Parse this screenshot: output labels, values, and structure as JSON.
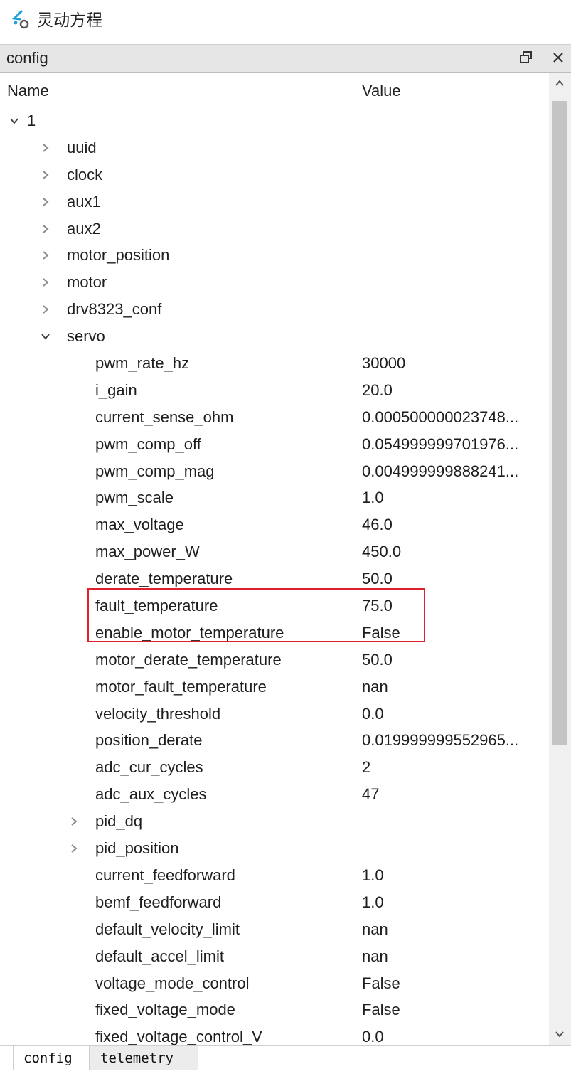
{
  "app": {
    "title": "灵动方程"
  },
  "panel": {
    "title": "config"
  },
  "columns": {
    "name": "Name",
    "value": "Value"
  },
  "rows": [
    {
      "label": "1",
      "value": "",
      "level": 0,
      "expander": "expanded"
    },
    {
      "label": "uuid",
      "value": "",
      "level": 1,
      "expander": "collapsed"
    },
    {
      "label": "clock",
      "value": "",
      "level": 1,
      "expander": "collapsed"
    },
    {
      "label": "aux1",
      "value": "",
      "level": 1,
      "expander": "collapsed"
    },
    {
      "label": "aux2",
      "value": "",
      "level": 1,
      "expander": "collapsed"
    },
    {
      "label": "motor_position",
      "value": "",
      "level": 1,
      "expander": "collapsed"
    },
    {
      "label": "motor",
      "value": "",
      "level": 1,
      "expander": "collapsed"
    },
    {
      "label": "drv8323_conf",
      "value": "",
      "level": 1,
      "expander": "collapsed"
    },
    {
      "label": "servo",
      "value": "",
      "level": 1,
      "expander": "expanded"
    },
    {
      "label": "pwm_rate_hz",
      "value": "30000",
      "level": 2,
      "expander": "none"
    },
    {
      "label": "i_gain",
      "value": "20.0",
      "level": 2,
      "expander": "none"
    },
    {
      "label": "current_sense_ohm",
      "value": "0.000500000023748...",
      "level": 2,
      "expander": "none"
    },
    {
      "label": "pwm_comp_off",
      "value": "0.054999999701976...",
      "level": 2,
      "expander": "none"
    },
    {
      "label": "pwm_comp_mag",
      "value": "0.004999999888241...",
      "level": 2,
      "expander": "none"
    },
    {
      "label": "pwm_scale",
      "value": "1.0",
      "level": 2,
      "expander": "none"
    },
    {
      "label": "max_voltage",
      "value": "46.0",
      "level": 2,
      "expander": "none"
    },
    {
      "label": "max_power_W",
      "value": "450.0",
      "level": 2,
      "expander": "none"
    },
    {
      "label": "derate_temperature",
      "value": "50.0",
      "level": 2,
      "expander": "none"
    },
    {
      "label": "fault_temperature",
      "value": "75.0",
      "level": 2,
      "expander": "none"
    },
    {
      "label": "enable_motor_temperature",
      "value": "False",
      "level": 2,
      "expander": "none"
    },
    {
      "label": "motor_derate_temperature",
      "value": "50.0",
      "level": 2,
      "expander": "none"
    },
    {
      "label": "motor_fault_temperature",
      "value": "nan",
      "level": 2,
      "expander": "none"
    },
    {
      "label": "velocity_threshold",
      "value": "0.0",
      "level": 2,
      "expander": "none"
    },
    {
      "label": "position_derate",
      "value": "0.019999999552965...",
      "level": 2,
      "expander": "none"
    },
    {
      "label": "adc_cur_cycles",
      "value": "2",
      "level": 2,
      "expander": "none"
    },
    {
      "label": "adc_aux_cycles",
      "value": "47",
      "level": 2,
      "expander": "none"
    },
    {
      "label": "pid_dq",
      "value": "",
      "level": 2,
      "expander": "collapsed"
    },
    {
      "label": "pid_position",
      "value": "",
      "level": 2,
      "expander": "collapsed"
    },
    {
      "label": "current_feedforward",
      "value": "1.0",
      "level": 2,
      "expander": "none"
    },
    {
      "label": "bemf_feedforward",
      "value": "1.0",
      "level": 2,
      "expander": "none"
    },
    {
      "label": "default_velocity_limit",
      "value": "nan",
      "level": 2,
      "expander": "none"
    },
    {
      "label": "default_accel_limit",
      "value": "nan",
      "level": 2,
      "expander": "none"
    },
    {
      "label": "voltage_mode_control",
      "value": "False",
      "level": 2,
      "expander": "none"
    },
    {
      "label": "fixed_voltage_mode",
      "value": "False",
      "level": 2,
      "expander": "none"
    },
    {
      "label": "fixed_voltage_control_V",
      "value": "0.0",
      "level": 2,
      "expander": "none"
    }
  ],
  "tabs": [
    {
      "label": "config"
    },
    {
      "label": "telemetry"
    }
  ],
  "colors": {
    "highlight": "#e0202a",
    "titlebar": "#e6e6e6",
    "logo_accent": "#1fa0d8"
  },
  "icons": {
    "logo": "app-logo-icon",
    "float": "float-window-icon",
    "close": "close-icon",
    "expanded": "chevron-down-icon",
    "collapsed": "chevron-right-icon",
    "scroll_up": "scroll-up-icon",
    "scroll_down": "scroll-down-icon"
  }
}
